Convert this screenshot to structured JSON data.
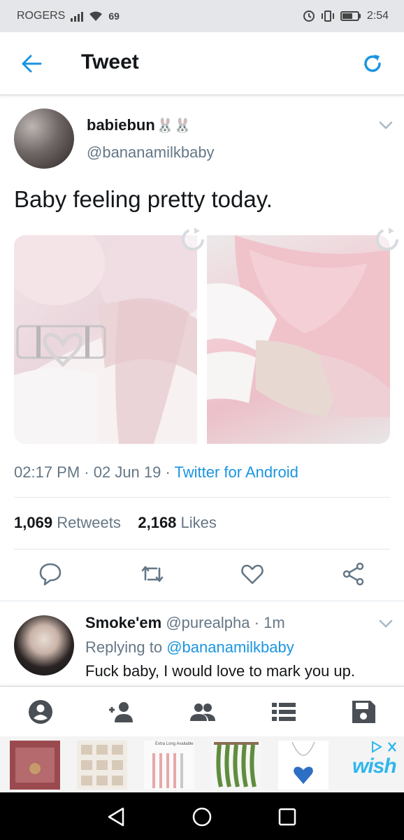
{
  "status_bar": {
    "carrier": "ROGERS",
    "signal_text": "69",
    "time": "2:54"
  },
  "header": {
    "title": "Tweet",
    "back_icon": "arrow-left-icon",
    "refresh_icon": "refresh-icon"
  },
  "tweet": {
    "display_name": "babiebun",
    "name_emoji": "🐰🐰",
    "handle": "@bananamilkbaby",
    "text": "Baby feeling pretty today.",
    "time": "02:17 PM",
    "date": "02 Jun 19",
    "source": "Twitter for Android",
    "meta_sep": " · ",
    "retweets_count": "1,069",
    "retweets_label": "Retweets",
    "likes_count": "2,168",
    "likes_label": "Likes",
    "actions": [
      "reply-icon",
      "retweet-icon",
      "like-icon",
      "share-icon"
    ]
  },
  "reply": {
    "display_name": "Smoke'em",
    "handle": "@purealpha",
    "time": "· 1m",
    "replying_prefix": "Replying to",
    "replying_to": "@bananamilkbaby",
    "text": "Fuck baby, I would love to mark you up."
  },
  "bottom_nav": [
    "profile-icon",
    "follow-icon",
    "people-icon",
    "list-icon",
    "save-icon"
  ],
  "ad": {
    "label": "Extra Long Available",
    "brand": "wish"
  },
  "colors": {
    "accent": "#1b95e0",
    "text": "#14171a",
    "muted": "#657786"
  }
}
